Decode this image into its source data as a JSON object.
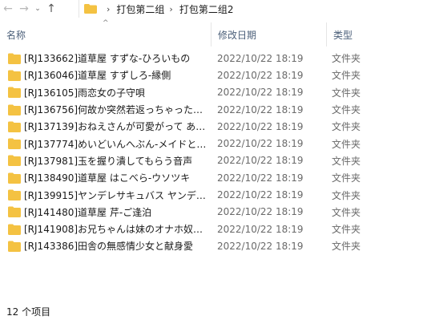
{
  "nav": {
    "back_icon": "arrow-left-icon",
    "forward_icon": "arrow-right-icon",
    "recent_icon": "chevron-down-icon",
    "up_icon": "arrow-up-icon"
  },
  "breadcrumb": [
    "打包第二组",
    "打包第二组2"
  ],
  "columns": {
    "name": "名称",
    "date": "修改日期",
    "type": "类型"
  },
  "folder_color": "#f4c242",
  "files": [
    {
      "name": "[RJ133662]道草屋 すずな-ひろいもの",
      "date": "2022/10/22 18:19",
      "type": "文件夹"
    },
    {
      "name": "[RJ136046]道草屋 すずしろ-縁側",
      "date": "2022/10/22 18:19",
      "type": "文件夹"
    },
    {
      "name": "[RJ136105]雨恋女の子守唄",
      "date": "2022/10/22 18:19",
      "type": "文件夹"
    },
    {
      "name": "[RJ136756]何故か突然若返っちゃった…",
      "date": "2022/10/22 18:19",
      "type": "文件夹"
    },
    {
      "name": "[RJ137139]おねえさんが可愛がって あ…",
      "date": "2022/10/22 18:19",
      "type": "文件夹"
    },
    {
      "name": "[RJ137774]めいどいんへぶん-メイドと…",
      "date": "2022/10/22 18:19",
      "type": "文件夹"
    },
    {
      "name": "[RJ137981]玉を握り潰してもらう音声",
      "date": "2022/10/22 18:19",
      "type": "文件夹"
    },
    {
      "name": "[RJ138490]道草屋 はこべら-ウソツキ",
      "date": "2022/10/22 18:19",
      "type": "文件夹"
    },
    {
      "name": "[RJ139915]ヤンデレサキュバス ヤンデ…",
      "date": "2022/10/22 18:19",
      "type": "文件夹"
    },
    {
      "name": "[RJ141480]道草屋 芹-ご逢泊",
      "date": "2022/10/22 18:19",
      "type": "文件夹"
    },
    {
      "name": "[RJ141908]お兄ちゃんは妹のオナホ奴…",
      "date": "2022/10/22 18:19",
      "type": "文件夹"
    },
    {
      "name": "[RJ143386]田舎の無感情少女と献身愛",
      "date": "2022/10/22 18:19",
      "type": "文件夹"
    }
  ],
  "status_text": "12 个项目"
}
